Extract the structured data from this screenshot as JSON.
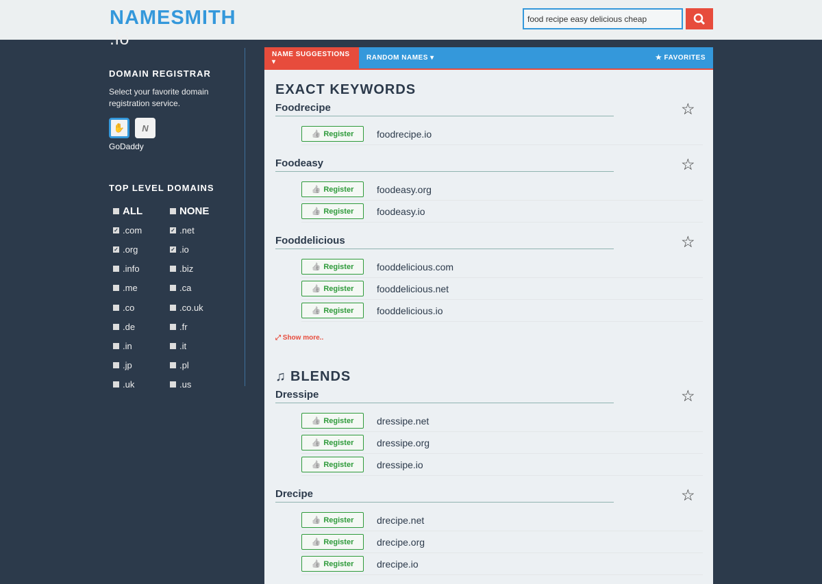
{
  "header": {
    "logo": "NAMESMITH",
    "logo_tld": ".io",
    "search_value": "food recipe easy delicious cheap"
  },
  "sidebar": {
    "registrar_title": "DOMAIN REGISTRAR",
    "registrar_desc": "Select your favorite domain registration service.",
    "registrar_selected": "GoDaddy",
    "tld_title": "TOP LEVEL DOMAINS",
    "tlds": [
      {
        "label": "ALL",
        "checked": false,
        "big": true
      },
      {
        "label": "NONE",
        "checked": false,
        "big": true
      },
      {
        "label": ".com",
        "checked": true
      },
      {
        "label": ".net",
        "checked": true
      },
      {
        "label": ".org",
        "checked": true
      },
      {
        "label": ".io",
        "checked": true
      },
      {
        "label": ".info",
        "checked": false
      },
      {
        "label": ".biz",
        "checked": false
      },
      {
        "label": ".me",
        "checked": false
      },
      {
        "label": ".ca",
        "checked": false
      },
      {
        "label": ".co",
        "checked": false
      },
      {
        "label": ".co.uk",
        "checked": false
      },
      {
        "label": ".de",
        "checked": false
      },
      {
        "label": ".fr",
        "checked": false
      },
      {
        "label": ".in",
        "checked": false
      },
      {
        "label": ".it",
        "checked": false
      },
      {
        "label": ".jp",
        "checked": false
      },
      {
        "label": ".pl",
        "checked": false
      },
      {
        "label": ".uk",
        "checked": false
      },
      {
        "label": ".us",
        "checked": false
      }
    ]
  },
  "nav": {
    "name_suggestions": "NAME SUGGESTIONS ▾",
    "random_names": "RANDOM NAMES ▾",
    "favorites": "★ FAVORITES"
  },
  "register_label": "Register",
  "sections": [
    {
      "title": "EXACT KEYWORDS",
      "icon": "",
      "show_more": "Show more..",
      "groups": [
        {
          "name": "Foodrecipe",
          "domains": [
            "foodrecipe.io"
          ]
        },
        {
          "name": "Foodeasy",
          "domains": [
            "foodeasy.org",
            "foodeasy.io"
          ]
        },
        {
          "name": "Fooddelicious",
          "domains": [
            "fooddelicious.com",
            "fooddelicious.net",
            "fooddelicious.io"
          ]
        }
      ]
    },
    {
      "title": "BLENDS",
      "icon": "♫",
      "groups": [
        {
          "name": "Dressipe",
          "domains": [
            "dressipe.net",
            "dressipe.org",
            "dressipe.io"
          ]
        },
        {
          "name": "Drecipe",
          "domains": [
            "drecipe.net",
            "drecipe.org",
            "drecipe.io"
          ]
        }
      ]
    }
  ]
}
